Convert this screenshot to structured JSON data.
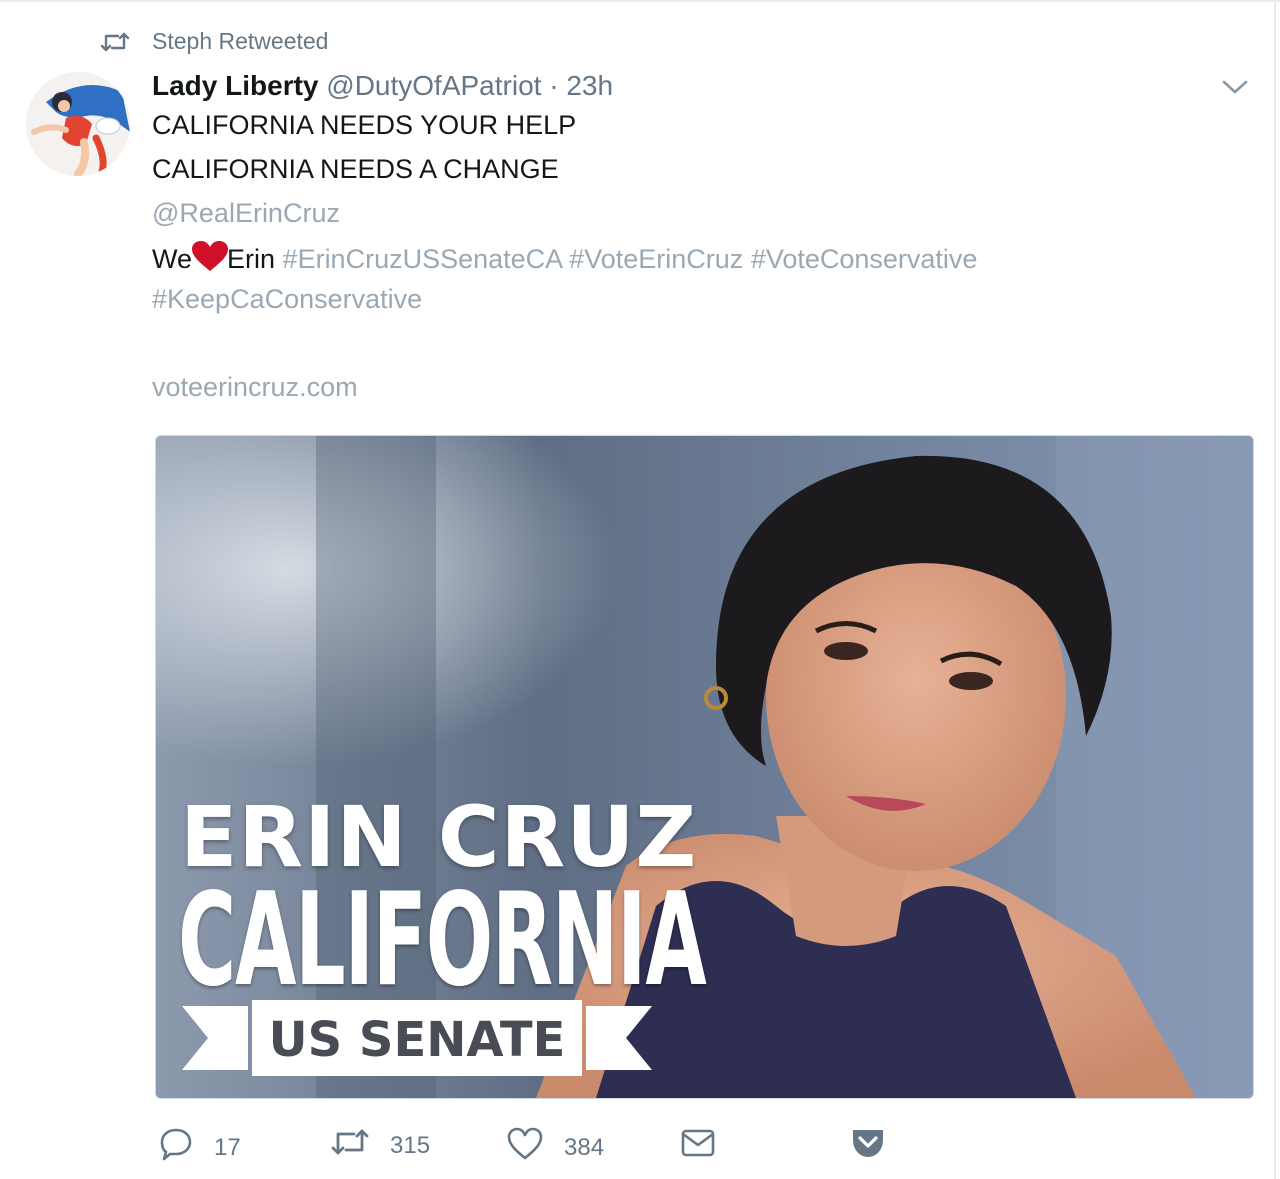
{
  "retweet_context": {
    "text": "Steph Retweeted",
    "icon": "retweet-icon"
  },
  "tweet": {
    "author_name": "Lady Liberty",
    "author_handle": "@DutyOfAPatriot",
    "separator": "·",
    "time": "23h",
    "lines": [
      "CALIFORNIA NEEDS YOUR HELP",
      "CALIFORNIA NEEDS A CHANGE",
      "@RealErinCruz"
    ],
    "love_line": {
      "before": "We",
      "after": "Erin",
      "emoji": "red-heart"
    },
    "hashtags": [
      "#ErinCruzUSSenateCA",
      "#VoteErinCruz",
      "#VoteConservative"
    ],
    "hashtag_line2": "#KeepCaConservative",
    "link": "voteerincruz.com"
  },
  "card": {
    "name": "ERIN CRUZ",
    "state": "CALIFORNIA",
    "office": "US SENATE"
  },
  "actions": {
    "reply_count": "17",
    "retweet_count": "315",
    "like_count": "384",
    "icons": [
      "reply-icon",
      "retweet-icon",
      "heart-icon",
      "direct-message-icon",
      "pocket-icon"
    ]
  },
  "colors": {
    "muted": "#657786",
    "link": "#9aa8b4",
    "heart": "#d0102a"
  }
}
